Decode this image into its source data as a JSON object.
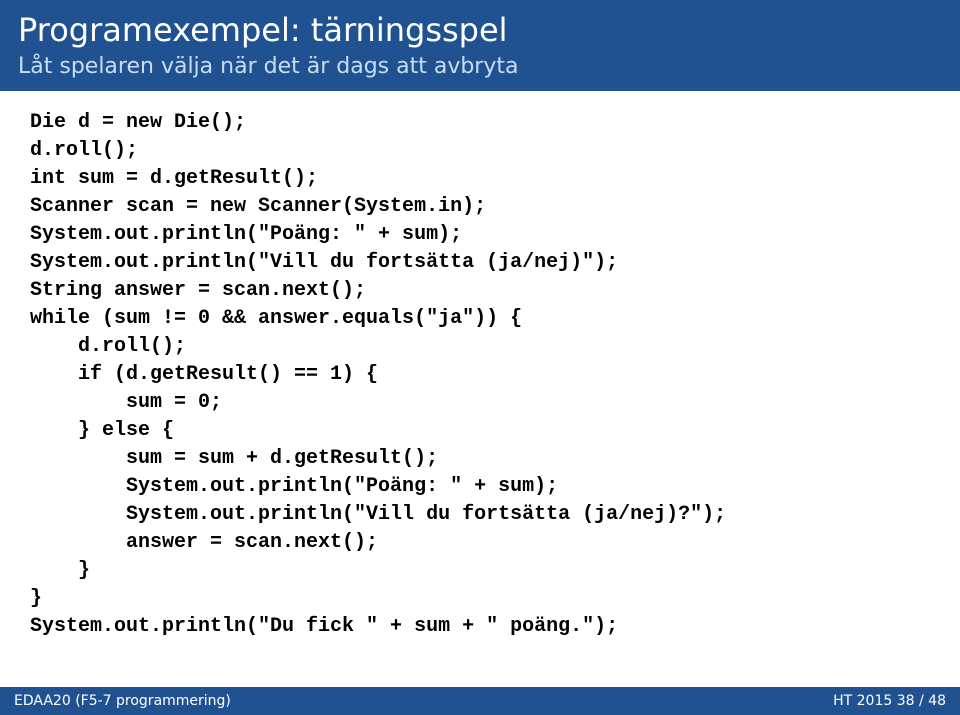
{
  "header": {
    "title": "Programexempel: tärningsspel",
    "subtitle": "Låt spelaren välja när det är dags att avbryta"
  },
  "code": "Die d = new Die();\nd.roll();\nint sum = d.getResult();\nScanner scan = new Scanner(System.in);\nSystem.out.println(\"Poäng: \" + sum);\nSystem.out.println(\"Vill du fortsätta (ja/nej)\");\nString answer = scan.next();\nwhile (sum != 0 && answer.equals(\"ja\")) {\n    d.roll();\n    if (d.getResult() == 1) {\n        sum = 0;\n    } else {\n        sum = sum + d.getResult();\n        System.out.println(\"Poäng: \" + sum);\n        System.out.println(\"Vill du fortsätta (ja/nej)?\");\n        answer = scan.next();\n    }\n}\nSystem.out.println(\"Du fick \" + sum + \" poäng.\");",
  "footer": {
    "left": "EDAA20 (F5-7 programmering)",
    "center": "",
    "right": "HT 2015    38 / 48"
  }
}
